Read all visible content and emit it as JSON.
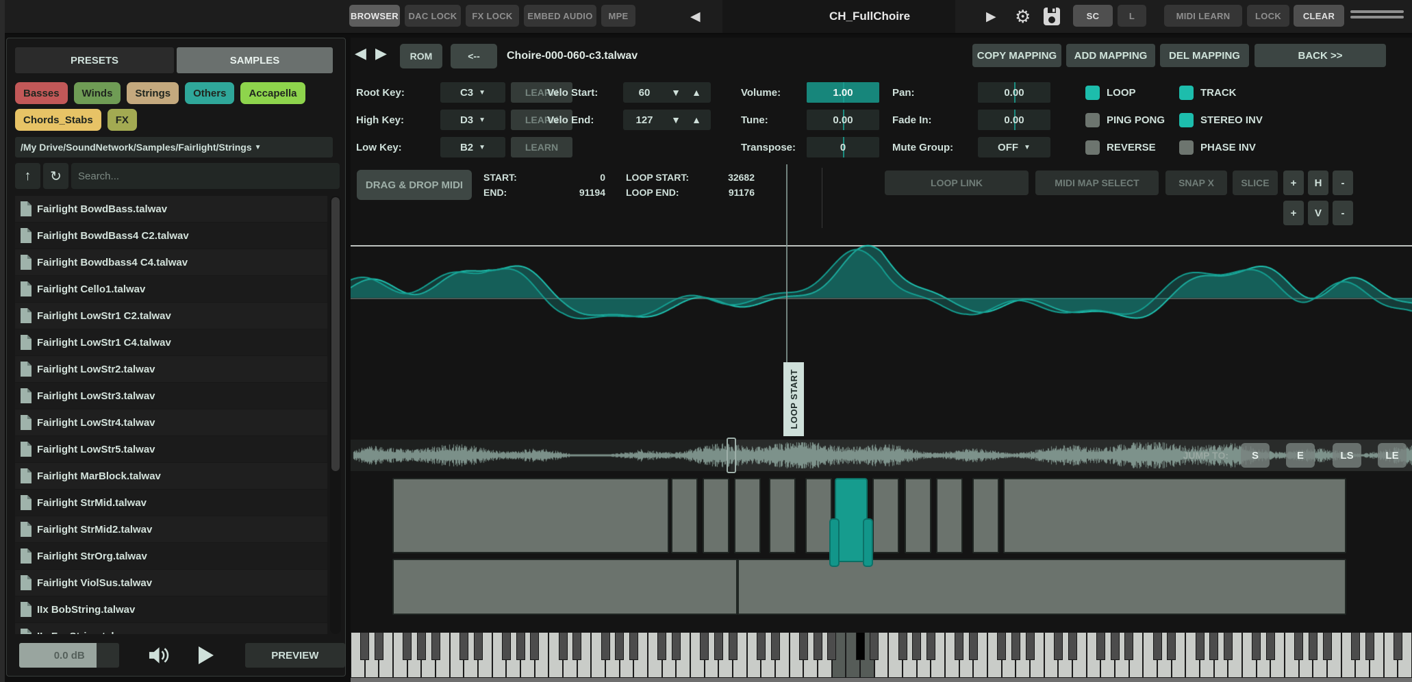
{
  "topbar": {
    "buttons": [
      {
        "label": "BROWSER",
        "active": true
      },
      {
        "label": "DAC LOCK",
        "active": false
      },
      {
        "label": "FX LOCK",
        "active": false
      },
      {
        "label": "EMBED AUDIO",
        "active": false
      },
      {
        "label": "MPE",
        "active": false
      }
    ],
    "prev_arrow": "◀",
    "preset_title": "CH_FullChoire",
    "play_arrow": "▶",
    "gear": "⚙",
    "sc_label": "SC",
    "l_label": "L",
    "midi_learn_label": "MIDI LEARN",
    "lock_label": "LOCK",
    "clear_label": "CLEAR"
  },
  "left_panel": {
    "tabs": {
      "presets": "PRESETS",
      "samples": "SAMPLES",
      "active": "SAMPLES"
    },
    "chips_row1": [
      {
        "label": "Basses",
        "color": "#c25858"
      },
      {
        "label": "Winds",
        "color": "#6f9c55"
      },
      {
        "label": "Strings",
        "color": "#c4a97e"
      },
      {
        "label": "Others",
        "color": "#2fa79a"
      },
      {
        "label": "Accapella",
        "color": "#8ed44c"
      }
    ],
    "chips_row2": [
      {
        "label": "Chords_Stabs",
        "color": "#e7c366"
      },
      {
        "label": "FX",
        "color": "#a3aa52"
      }
    ],
    "path": "/My Drive/SoundNetwork/Samples/Fairlight/Strings",
    "path_tri": "▼",
    "up_glyph": "↑",
    "refresh_glyph": "↻",
    "search_placeholder": "Search...",
    "files": [
      "Fairlight BowdBass.talwav",
      "Fairlight BowdBass4 C2.talwav",
      "Fairlight Bowdbass4 C4.talwav",
      "Fairlight Cello1.talwav",
      "Fairlight LowStr1 C2.talwav",
      "Fairlight LowStr1 C4.talwav",
      "Fairlight LowStr2.talwav",
      "Fairlight LowStr3.talwav",
      "Fairlight LowStr4.talwav",
      "Fairlight LowStr5.talwav",
      "Fairlight MarBlock.talwav",
      "Fairlight StrMid.talwav",
      "Fairlight StrMid2.talwav",
      "Fairlight StrOrg.talwav",
      "Fairlight ViolSus.talwav",
      "IIx BobString.talwav",
      "IIx FenString.talwav"
    ],
    "footer": {
      "gain": "0.0 dB",
      "preview": "PREVIEW"
    }
  },
  "sample_header": {
    "prev": "◀",
    "next": "▶",
    "rom": "ROM",
    "back_arrow": "<--",
    "filename": "Choire-000-060-c3.talwav",
    "copy_mapping": "COPY MAPPING",
    "add_mapping": "ADD MAPPING",
    "del_mapping": "DEL MAPPING",
    "back": "BACK >>"
  },
  "params": {
    "root_key": {
      "label": "Root Key:",
      "value": "C3",
      "learn": "LEARN"
    },
    "high_key": {
      "label": "High Key:",
      "value": "D3",
      "learn": "LEARN"
    },
    "low_key": {
      "label": "Low Key:",
      "value": "B2",
      "learn": "LEARN"
    },
    "velo_start": {
      "label": "Velo Start:",
      "value": "60"
    },
    "velo_end": {
      "label": "Velo End:",
      "value": "127"
    },
    "stepper_down": "▼",
    "stepper_up": "▲",
    "dropdown_tri": "▼",
    "volume": {
      "label": "Volume:",
      "value": "1.00"
    },
    "tune": {
      "label": "Tune:",
      "value": "0.00"
    },
    "transpose": {
      "label": "Transpose:",
      "value": "0"
    },
    "pan": {
      "label": "Pan:",
      "value": "0.00"
    },
    "fade_in": {
      "label": "Fade In:",
      "value": "0.00"
    },
    "mute_group": {
      "label": "Mute Group:",
      "value": "OFF"
    },
    "toggles_col1": [
      {
        "label": "LOOP",
        "on": true
      },
      {
        "label": "PING PONG",
        "on": false
      },
      {
        "label": "REVERSE",
        "on": false
      }
    ],
    "toggles_col2": [
      {
        "label": "TRACK",
        "on": true
      },
      {
        "label": "STEREO INV",
        "on": true
      },
      {
        "label": "PHASE INV",
        "on": false
      }
    ]
  },
  "sample_info": {
    "drag_drop": "DRAG & DROP MIDI",
    "start_label": "START:",
    "start": "0",
    "end_label": "END:",
    "end": "91194",
    "loop_start_label": "LOOP START:",
    "loop_start": "32682",
    "loop_end_label": "LOOP END:",
    "loop_end": "91176"
  },
  "wave_tools": {
    "loop_link": "LOOP LINK",
    "midi_map_select": "MIDI MAP SELECT",
    "snap_x": "SNAP X",
    "slice": "SLICE",
    "zoom_plus": "+",
    "zoom_h": "H",
    "zoom_minus": "-",
    "zoom_v": "V"
  },
  "waveform": {
    "loop_start_marker": "LOOP START",
    "loop_start_frac": 0.358,
    "accent": "#1fc0af",
    "fill": "rgba(23,132,124,0.5)",
    "overview_color": "#8ca49c",
    "jump_to": "JUMP TO:",
    "jump_s": "S",
    "jump_e": "E",
    "jump_ls": "LS",
    "jump_le": "LE"
  },
  "sample_map": {
    "top_zones": [
      {
        "x0": 0.0,
        "x1": 0.29,
        "selected": false
      },
      {
        "x0": 0.292,
        "x1": 0.32,
        "selected": false
      },
      {
        "x0": 0.325,
        "x1": 0.353,
        "selected": false
      },
      {
        "x0": 0.358,
        "x1": 0.386,
        "selected": false
      },
      {
        "x0": 0.395,
        "x1": 0.423,
        "selected": false
      },
      {
        "x0": 0.433,
        "x1": 0.461,
        "selected": false
      },
      {
        "x0": 0.464,
        "x1": 0.498,
        "selected": true
      },
      {
        "x0": 0.503,
        "x1": 0.531,
        "selected": false
      },
      {
        "x0": 0.537,
        "x1": 0.565,
        "selected": false
      },
      {
        "x0": 0.57,
        "x1": 0.598,
        "selected": false
      },
      {
        "x0": 0.608,
        "x1": 0.636,
        "selected": false
      },
      {
        "x0": 0.64,
        "x1": 1.0,
        "selected": false
      }
    ],
    "bottom_zones": [
      {
        "x0": 0.0,
        "x1": 0.362,
        "selected": false
      },
      {
        "x0": 0.362,
        "x1": 1.0,
        "selected": false
      }
    ]
  },
  "keyboard": {
    "white_keys": 75,
    "range_low": "B2",
    "range_high": "D3",
    "highlight_white_start": 34,
    "highlight_white_end": 36,
    "highlight_black_after": 35
  }
}
